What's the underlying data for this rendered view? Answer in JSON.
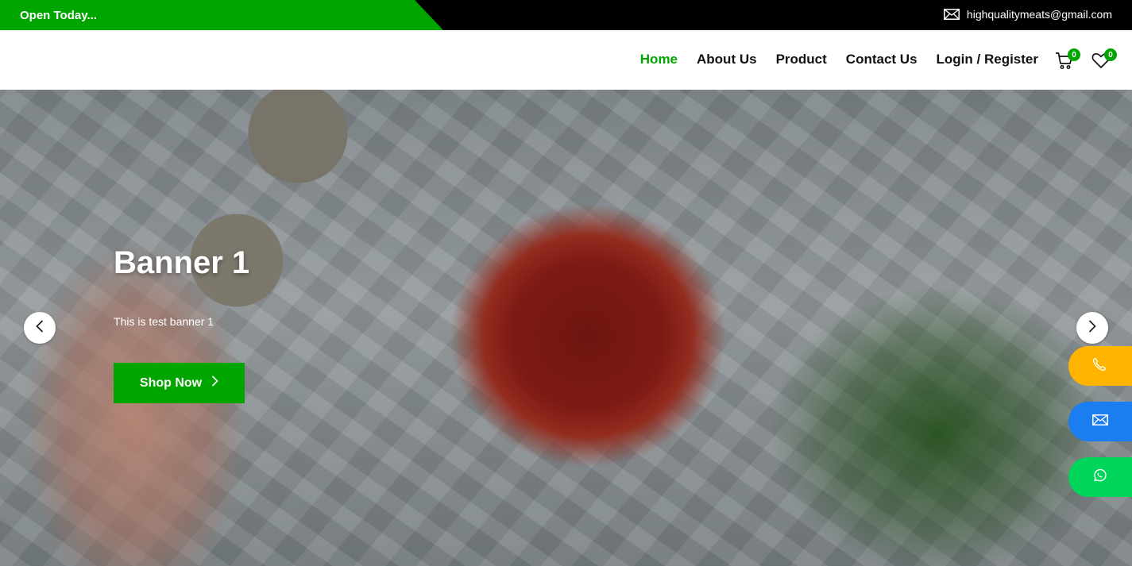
{
  "topbar": {
    "open_text": "Open Today...",
    "email": "highqualitymeats@gmail.com",
    "email_icon": "envelope-icon"
  },
  "nav": {
    "items": [
      {
        "label": "Home",
        "active": true
      },
      {
        "label": "About Us"
      },
      {
        "label": "Product"
      },
      {
        "label": "Contact Us"
      },
      {
        "label": "Login / Register"
      }
    ],
    "cart_count": "0",
    "wishlist_count": "0",
    "active_color": "#00a500"
  },
  "banner": {
    "title": "Banner 1",
    "subtitle": "This is test banner 1",
    "button_label": "Shop Now"
  },
  "floating_contacts": [
    {
      "icon": "phone-icon",
      "color": "#ffb400"
    },
    {
      "icon": "envelope-icon",
      "color": "#1a7df0"
    },
    {
      "icon": "whatsapp-icon",
      "color": "#00d45a"
    }
  ]
}
